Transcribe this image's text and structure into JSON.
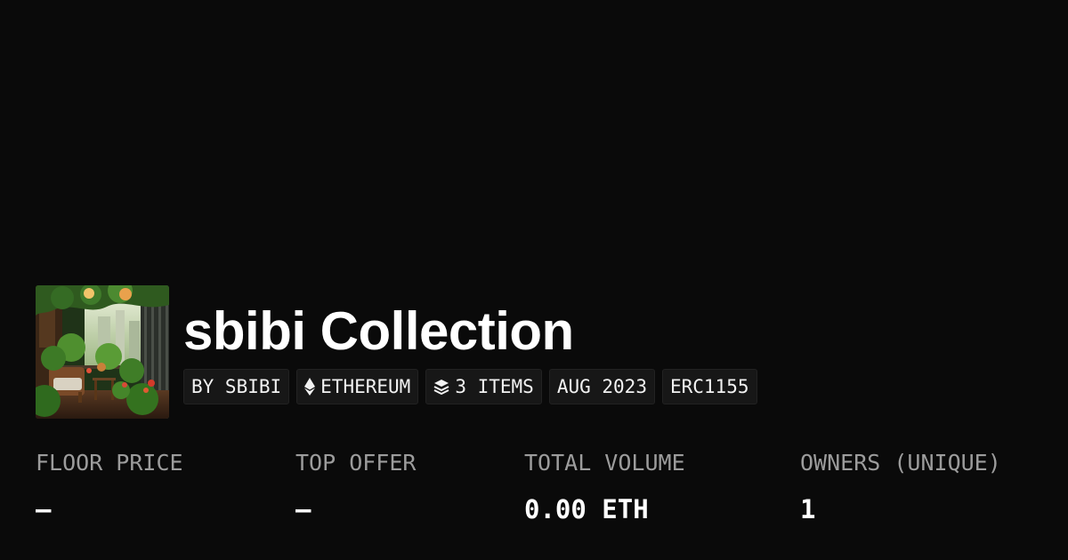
{
  "collection": {
    "name": "sbibi Collection",
    "thumbnail_icon": "collection-thumbnail-image"
  },
  "tags": [
    {
      "label": "BY SBIBI",
      "icon": ""
    },
    {
      "label": "ETHEREUM",
      "icon": "ethereum-icon"
    },
    {
      "label": "3 ITEMS",
      "icon": "layers-icon"
    },
    {
      "label": "AUG 2023",
      "icon": ""
    },
    {
      "label": "ERC1155",
      "icon": ""
    }
  ],
  "stats": [
    {
      "label": "FLOOR PRICE",
      "value": "–"
    },
    {
      "label": "TOP OFFER",
      "value": "–"
    },
    {
      "label": "TOTAL VOLUME",
      "value": "0.00 ETH"
    },
    {
      "label": "OWNERS (UNIQUE)",
      "value": "1"
    }
  ],
  "colors": {
    "background": "#0a0a0a",
    "tag_background": "#171717",
    "label_gray": "#9c9c9c",
    "text": "#ffffff"
  }
}
